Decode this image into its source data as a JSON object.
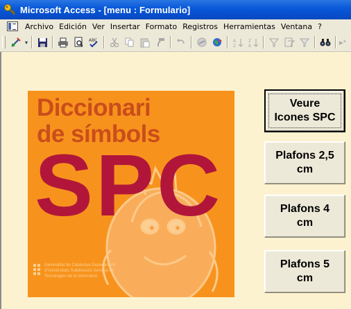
{
  "window": {
    "title": "Microsoft Access - [menu : Formulario]"
  },
  "menubar": {
    "items": [
      {
        "label": "Archivo"
      },
      {
        "label": "Edición"
      },
      {
        "label": "Ver"
      },
      {
        "label": "Insertar"
      },
      {
        "label": "Formato"
      },
      {
        "label": "Registros"
      },
      {
        "label": "Herramientas"
      },
      {
        "label": "Ventana"
      },
      {
        "label": "?"
      }
    ]
  },
  "toolbar": {
    "icons": [
      "design-view-icon",
      "save-icon",
      "print-icon",
      "print-preview-icon",
      "spelling-icon",
      "cut-icon",
      "copy-icon",
      "paste-icon",
      "format-painter-icon",
      "undo-icon",
      "insert-hyperlink-icon",
      "web-toolbar-icon",
      "sort-ascending-icon",
      "sort-descending-icon",
      "filter-by-selection-icon",
      "filter-by-form-icon",
      "apply-filter-icon",
      "find-icon",
      "new-record-icon"
    ]
  },
  "cover": {
    "title_line1": "Diccionari",
    "title_line2": "de símbols",
    "big_text": "SPC",
    "logo_text": "Generalitat de Catalunya Departament d'Universitats Subdirecció General de Tecnologies de la Informació"
  },
  "buttons": {
    "veure": "Veure\nIcones SPC",
    "plafons25": "Plafons 2,5\ncm",
    "plafons4": "Plafons 4\ncm",
    "plafons5": "Plafons  5\ncm"
  },
  "colors": {
    "titlebar": "#0a5ad9",
    "cover_background": "#f7931d",
    "cover_title": "#ca4d1a",
    "cover_big": "#b1163a",
    "form_background": "#fdf2cf"
  }
}
